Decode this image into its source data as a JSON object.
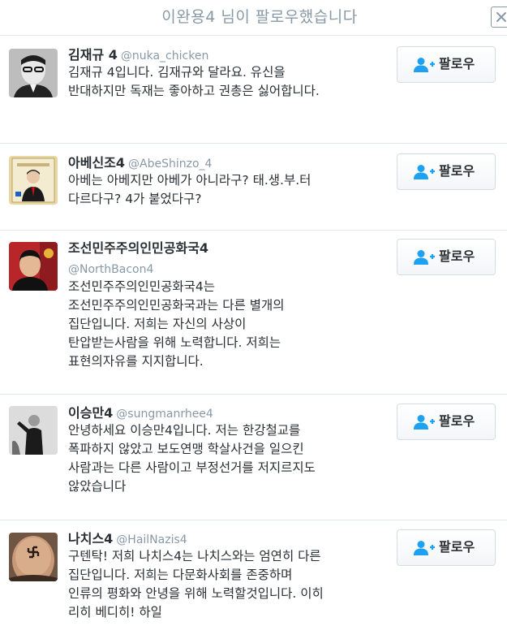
{
  "header": {
    "title": "이완용4 님이 팔로우했습니다",
    "close_icon": "close-icon"
  },
  "follow_label": "팔로우",
  "colors": {
    "handle": "#8899a6",
    "text": "#292f33",
    "divider": "#e1e8ed",
    "follow_icon": "#1da1f2"
  },
  "users": [
    {
      "name": "김재규 4",
      "handle": "@nuka_chicken",
      "bio": "김재규 4입니다. 김재규와 달라요. 유신을 반대하지만 독재는 좋아하고 권총은 싫어합니다."
    },
    {
      "name": "아베신조4",
      "handle": "@AbeShinzo_4",
      "bio": "아베는 아베지만 아베가 아니라구? 태.생.부.터 다르다구? 4가 붙었다구?"
    },
    {
      "name": "조선민주주의인민공화국4",
      "handle": "@NorthBacon4",
      "bio": "조선민주주의인민공화국4는 조선민주주의인민공화국과는 다른 별개의 집단입니다. 저희는 자신의 사상이 탄압받는사람을 위해 노력합니다. 저희는 표현의자유를 지지합니다."
    },
    {
      "name": "이승만4",
      "handle": "@sungmanrhee4",
      "bio": "안녕하세요 이승만4입니다. 저는 한강철교를 폭파하지 않았고 보도연맹 학살사건을 일으킨 사람과는 다른 사람이고 부정선거를 저지르지도 않았습니다"
    },
    {
      "name": "나치스4",
      "handle": "@HailNazis4",
      "bio": "구텐탁! 저희 나치스4는 나치스와는 엄연히 다른 집단입니다. 저희는 다문화사회를 존중하며 인류의 평화와 안녕을 위해 노력할것입니다. 이히 리히 베디히! 하일"
    }
  ]
}
